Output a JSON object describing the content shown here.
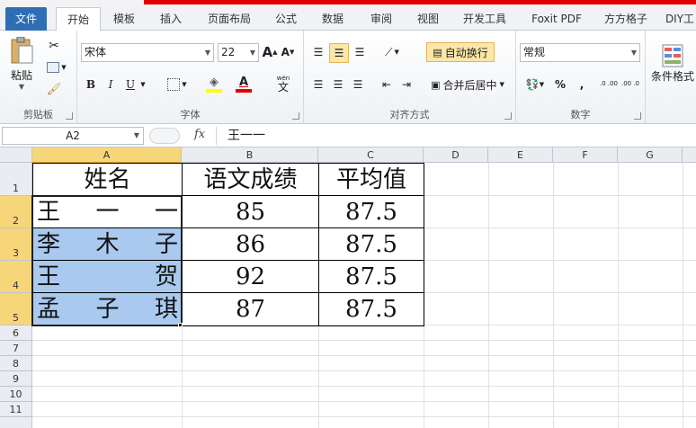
{
  "tabs": [
    "文件",
    "开始",
    "模板",
    "插入",
    "页面布局",
    "公式",
    "数据",
    "审阅",
    "视图",
    "开发工具",
    "Foxit PDF",
    "方方格子",
    "DIY工"
  ],
  "ribbon": {
    "clipboard": {
      "paste": "粘贴",
      "label": "剪贴板"
    },
    "font": {
      "name": "宋体",
      "size": "22",
      "bold": "B",
      "italic": "I",
      "underline": "U",
      "grow": "A",
      "shrink": "A",
      "color_a": "A",
      "wen": "wén",
      "label": "字体"
    },
    "align": {
      "wrap": "自动换行",
      "merge": "合并后居中",
      "label": "对齐方式"
    },
    "number": {
      "format": "常规",
      "percent": "%",
      "comma": ",",
      "inc": ".0 .00",
      "dec": ".00 .0",
      "label": "数字"
    },
    "styles": {
      "cond": "条件格式"
    }
  },
  "formula_bar": {
    "name_box": "A2",
    "fx": "fx",
    "content": "王一一"
  },
  "columns": [
    "A",
    "B",
    "C",
    "D",
    "E",
    "F",
    "G"
  ],
  "rows": [
    "1",
    "2",
    "3",
    "4",
    "5",
    "6",
    "7",
    "8",
    "9",
    "10",
    "11"
  ],
  "table": {
    "headers": [
      "姓名",
      "语文成绩",
      "平均值"
    ],
    "rows": [
      {
        "name": [
          "王",
          "一",
          "一"
        ],
        "score": "85",
        "avg": "87.5"
      },
      {
        "name": [
          "李",
          "木",
          "子"
        ],
        "score": "86",
        "avg": "87.5"
      },
      {
        "name": [
          "王",
          "贺"
        ],
        "score": "92",
        "avg": "87.5"
      },
      {
        "name": [
          "孟",
          "子",
          "琪"
        ],
        "score": "87",
        "avg": "87.5"
      }
    ]
  },
  "colors": {
    "selection": "#a9c9ef",
    "header_selected": "#f7d67a",
    "file_tab": "#2f6db5"
  }
}
